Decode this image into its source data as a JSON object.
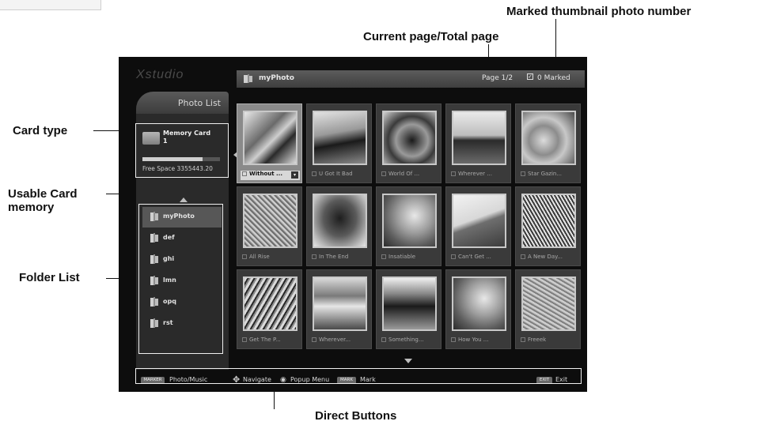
{
  "annotations": {
    "marked_thumb": "Marked thumbnail photo number",
    "current_page": "Current page/Total page",
    "card_type": "Card type",
    "usable_memory_line1": "Usable Card",
    "usable_memory_line2": "memory",
    "folder_list": "Folder List",
    "direct_buttons": "Direct Buttons"
  },
  "screen": {
    "logo": "Xstudio",
    "tab_label": "Photo List",
    "header": {
      "folder": "myPhoto",
      "page": "Page 1/2",
      "marked": "0 Marked"
    },
    "card": {
      "name_line1": "Memory Card",
      "name_line2": "1",
      "usage_fraction": 0.78,
      "free_space": "Free Space 3355443.20"
    },
    "folders": [
      {
        "label": "myPhoto",
        "selected": true
      },
      {
        "label": "def",
        "selected": false
      },
      {
        "label": "ghi",
        "selected": false
      },
      {
        "label": "lmn",
        "selected": false
      },
      {
        "label": "opq",
        "selected": false
      },
      {
        "label": "rst",
        "selected": false
      }
    ],
    "thumbnails": [
      {
        "caption": "Without ...",
        "selected": true
      },
      {
        "caption": "U Got It Bad",
        "selected": false
      },
      {
        "caption": "World Of ...",
        "selected": false
      },
      {
        "caption": "Wherever ...",
        "selected": false
      },
      {
        "caption": "Star Gazin...",
        "selected": false
      },
      {
        "caption": "All Rise",
        "selected": false
      },
      {
        "caption": "In The End",
        "selected": false
      },
      {
        "caption": "Insatiable",
        "selected": false
      },
      {
        "caption": "Can't Get ...",
        "selected": false
      },
      {
        "caption": "A New Day...",
        "selected": false
      },
      {
        "caption": "Get The P...",
        "selected": false
      },
      {
        "caption": "Wherever...",
        "selected": false
      },
      {
        "caption": "Something...",
        "selected": false
      },
      {
        "caption": "How You ...",
        "selected": false
      },
      {
        "caption": "Freeek",
        "selected": false
      }
    ],
    "bottom_bar": {
      "btn1_chip": "MARKER",
      "btn1": "Photo/Music",
      "btn2": "Navigate",
      "btn3": "Popup Menu",
      "btn4_chip": "MARK",
      "btn4": "Mark",
      "btn5_chip": "EXIT",
      "btn5": "Exit"
    }
  }
}
